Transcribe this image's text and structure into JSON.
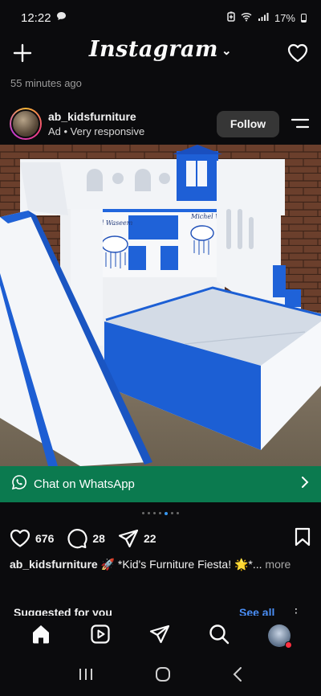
{
  "status_bar": {
    "time": "12:22",
    "battery": "17%"
  },
  "header": {
    "logo": "Instagram",
    "logo_chevron": "⌄"
  },
  "post": {
    "time_ago": "55 minutes ago",
    "account_name": "ab_kidsfurniture",
    "account_sub": "Ad • Very responsive",
    "follow_label": "Follow",
    "image_alt": "White and blue kids bunk bed with slide",
    "image_text_left": "al Waseem",
    "image_text_right": "Michel Waseem",
    "cta_label": "Chat on WhatsApp",
    "carousel_count": 7,
    "carousel_active": 5,
    "likes": "676",
    "comments": "28",
    "shares": "22",
    "caption_user": "ab_kidsfurniture",
    "caption_text": " 🚀 *Kid's Furniture Fiesta! 🌟*...",
    "caption_more": " more"
  },
  "suggested": {
    "title": "Suggested for you",
    "see_all": "See all",
    "more": "⋮"
  },
  "nav": {
    "items": [
      "home-icon",
      "reels-icon",
      "direct-message-icon",
      "search-icon",
      "profile-avatar"
    ]
  },
  "colors": {
    "accent": "#3897f0",
    "cta": "#0b7a4f",
    "background": "#0b0b0d",
    "notification": "#ff3040"
  }
}
